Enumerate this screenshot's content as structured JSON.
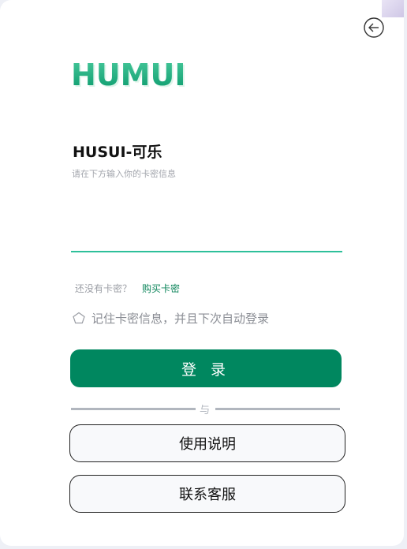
{
  "logo": {
    "text": "HUMUI"
  },
  "header": {
    "title": "HUSUI-可乐",
    "subtitle": "请在下方输入你的卡密信息"
  },
  "form": {
    "card_value": "",
    "card_placeholder": "",
    "no_card_text": "还没有卡密？",
    "buy_link": "购买卡密",
    "remember_label": "记住卡密信息，并且下次自动登录",
    "login_label": "登 录"
  },
  "divider": {
    "text": "与"
  },
  "buttons": {
    "help_label": "使用说明",
    "support_label": "联系客服"
  },
  "colors": {
    "primary": "#00875f",
    "input_underline": "#2ec09a",
    "link": "#10875d"
  },
  "icons": {
    "back": "arrow-left-circle-icon",
    "remember": "pentagon-outline-icon"
  }
}
